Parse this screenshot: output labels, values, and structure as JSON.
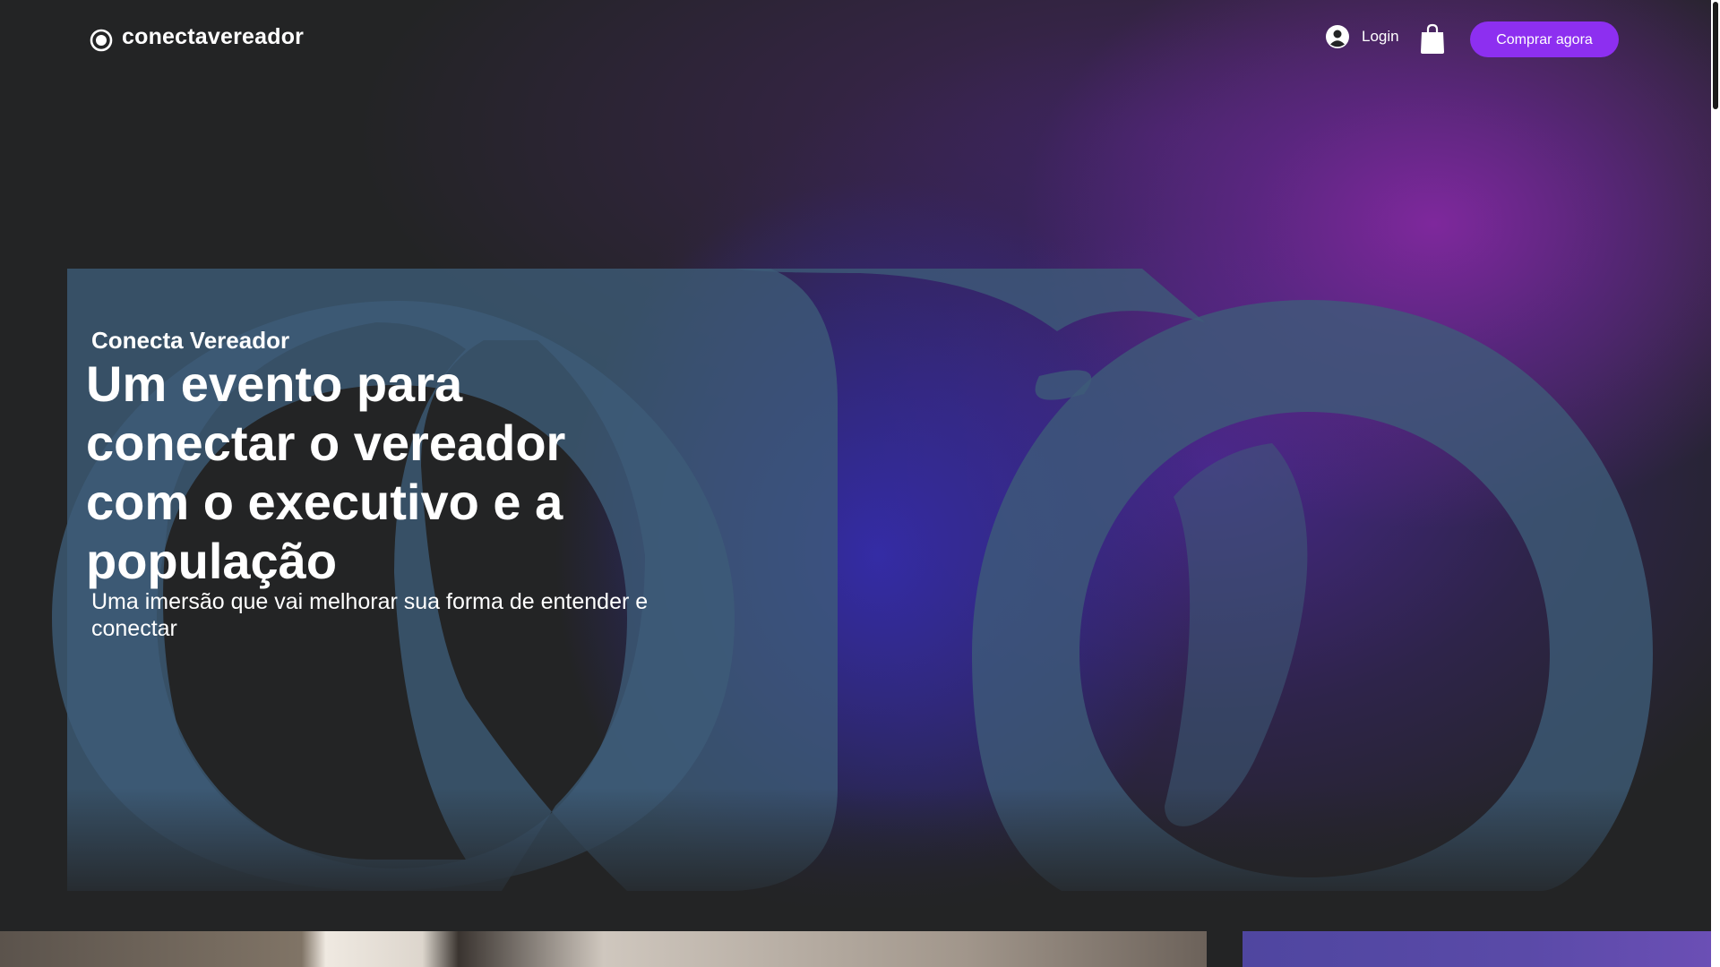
{
  "header": {
    "brand_name": "conectavereador",
    "brand_icon": "radio-dot-icon",
    "login_label": "Login",
    "login_icon": "user-avatar-icon",
    "cart_icon": "shopping-bag-icon",
    "buy_button_label": "Comprar agora"
  },
  "hero": {
    "eyebrow": "Conecta Vereador",
    "headline": "Um evento para conectar o vereador com o executivo e a população",
    "subtitle": "Uma imersão que vai melhorar sua forma de entender e conectar"
  },
  "colors": {
    "background": "#232425",
    "accent": "#8d2ff0",
    "logo_shape": "#3d5b77",
    "text": "#ffffff"
  }
}
